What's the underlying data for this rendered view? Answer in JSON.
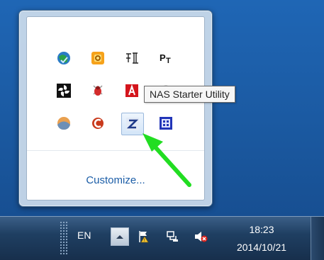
{
  "flyout": {
    "customize_label": "Customize...",
    "icons": [
      {
        "name": "network-globe-icon"
      },
      {
        "name": "outlook-icon"
      },
      {
        "name": "input-method-icon"
      },
      {
        "name": "pt-app-icon"
      },
      {
        "name": "fan-icon"
      },
      {
        "name": "shield-bug-icon"
      },
      {
        "name": "adobe-icon"
      },
      {
        "name": "hidden-icon"
      },
      {
        "name": "weather-icon"
      },
      {
        "name": "ccleaner-icon"
      },
      {
        "name": "nas-starter-utility-icon"
      },
      {
        "name": "grid-app-icon"
      }
    ]
  },
  "tooltip": {
    "text": "NAS Starter Utility"
  },
  "taskbar": {
    "language": "EN",
    "clock": {
      "time": "18:23",
      "date": "2014/10/21"
    }
  },
  "colors": {
    "arrow": "#22dd22",
    "link": "#1b5da7",
    "desktop": "#1c5fa8"
  }
}
